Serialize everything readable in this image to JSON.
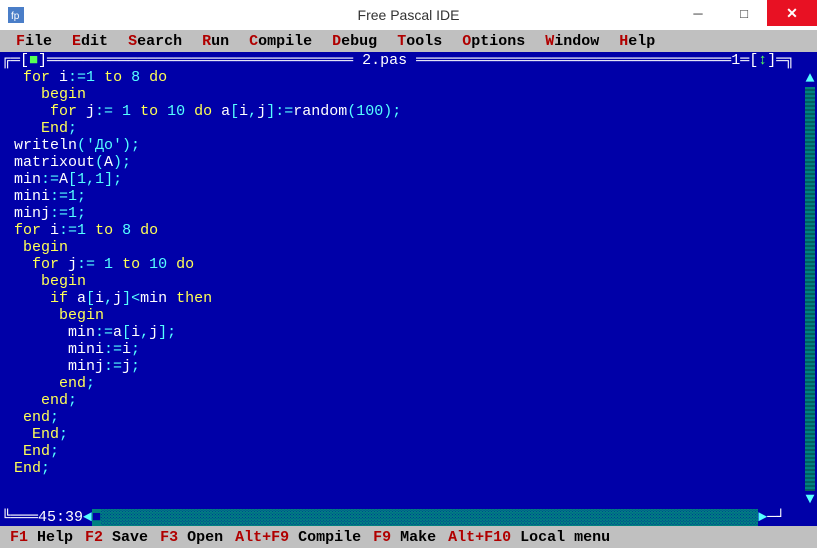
{
  "window": {
    "title": "Free Pascal IDE"
  },
  "menu": [
    {
      "hotkey": "F",
      "rest": "ile"
    },
    {
      "hotkey": "E",
      "rest": "dit"
    },
    {
      "hotkey": "S",
      "rest": "earch"
    },
    {
      "hotkey": "R",
      "rest": "un"
    },
    {
      "hotkey": "C",
      "rest": "ompile"
    },
    {
      "hotkey": "D",
      "rest": "ebug"
    },
    {
      "hotkey": "T",
      "rest": "ools"
    },
    {
      "hotkey": "O",
      "rest": "ptions"
    },
    {
      "hotkey": "W",
      "rest": "indow"
    },
    {
      "hotkey": "H",
      "rest": "elp"
    }
  ],
  "editor": {
    "filename": "2.pas",
    "window_number": "1",
    "cursor_pos": "45:39",
    "lines": [
      [
        {
          "c": "y",
          "t": " for "
        },
        {
          "c": "w",
          "t": "i"
        },
        {
          "c": "c",
          "t": ":="
        },
        {
          "c": "c",
          "t": "1"
        },
        {
          "c": "y",
          "t": " to "
        },
        {
          "c": "c",
          "t": "8"
        },
        {
          "c": "y",
          "t": " do"
        }
      ],
      [
        {
          "c": "y",
          "t": "   begin"
        }
      ],
      [
        {
          "c": "y",
          "t": "    for "
        },
        {
          "c": "w",
          "t": "j"
        },
        {
          "c": "c",
          "t": ":= "
        },
        {
          "c": "c",
          "t": "1"
        },
        {
          "c": "y",
          "t": " to "
        },
        {
          "c": "c",
          "t": "10"
        },
        {
          "c": "y",
          "t": " do "
        },
        {
          "c": "w",
          "t": "a"
        },
        {
          "c": "c",
          "t": "["
        },
        {
          "c": "w",
          "t": "i"
        },
        {
          "c": "c",
          "t": ","
        },
        {
          "c": "w",
          "t": "j"
        },
        {
          "c": "c",
          "t": "]:="
        },
        {
          "c": "w",
          "t": "random"
        },
        {
          "c": "c",
          "t": "("
        },
        {
          "c": "c",
          "t": "100"
        },
        {
          "c": "c",
          "t": ");"
        }
      ],
      [
        {
          "c": "y",
          "t": "   End"
        },
        {
          "c": "c",
          "t": ";"
        }
      ],
      [
        {
          "c": "w",
          "t": "writeln"
        },
        {
          "c": "c",
          "t": "('До');"
        }
      ],
      [
        {
          "c": "w",
          "t": "matrixout"
        },
        {
          "c": "c",
          "t": "("
        },
        {
          "c": "w",
          "t": "A"
        },
        {
          "c": "c",
          "t": ");"
        }
      ],
      [
        {
          "c": "w",
          "t": "min"
        },
        {
          "c": "c",
          "t": ":="
        },
        {
          "c": "w",
          "t": "A"
        },
        {
          "c": "c",
          "t": "["
        },
        {
          "c": "c",
          "t": "1"
        },
        {
          "c": "c",
          "t": ","
        },
        {
          "c": "c",
          "t": "1"
        },
        {
          "c": "c",
          "t": "];"
        }
      ],
      [
        {
          "c": "w",
          "t": "mini"
        },
        {
          "c": "c",
          "t": ":="
        },
        {
          "c": "c",
          "t": "1"
        },
        {
          "c": "c",
          "t": ";"
        }
      ],
      [
        {
          "c": "w",
          "t": "minj"
        },
        {
          "c": "c",
          "t": ":="
        },
        {
          "c": "c",
          "t": "1"
        },
        {
          "c": "c",
          "t": ";"
        }
      ],
      [
        {
          "c": "y",
          "t": "for "
        },
        {
          "c": "w",
          "t": "i"
        },
        {
          "c": "c",
          "t": ":="
        },
        {
          "c": "c",
          "t": "1"
        },
        {
          "c": "y",
          "t": " to "
        },
        {
          "c": "c",
          "t": "8"
        },
        {
          "c": "y",
          "t": " do"
        }
      ],
      [
        {
          "c": "y",
          "t": " begin"
        }
      ],
      [
        {
          "c": "y",
          "t": "  for "
        },
        {
          "c": "w",
          "t": "j"
        },
        {
          "c": "c",
          "t": ":= "
        },
        {
          "c": "c",
          "t": "1"
        },
        {
          "c": "y",
          "t": " to "
        },
        {
          "c": "c",
          "t": "10"
        },
        {
          "c": "y",
          "t": " do"
        }
      ],
      [
        {
          "c": "y",
          "t": "   begin"
        }
      ],
      [
        {
          "c": "y",
          "t": "    if "
        },
        {
          "c": "w",
          "t": "a"
        },
        {
          "c": "c",
          "t": "["
        },
        {
          "c": "w",
          "t": "i"
        },
        {
          "c": "c",
          "t": ","
        },
        {
          "c": "w",
          "t": "j"
        },
        {
          "c": "c",
          "t": "]<"
        },
        {
          "c": "w",
          "t": "min"
        },
        {
          "c": "y",
          "t": " then"
        }
      ],
      [
        {
          "c": "y",
          "t": "     begin"
        }
      ],
      [
        {
          "c": "w",
          "t": "      min"
        },
        {
          "c": "c",
          "t": ":="
        },
        {
          "c": "w",
          "t": "a"
        },
        {
          "c": "c",
          "t": "["
        },
        {
          "c": "w",
          "t": "i"
        },
        {
          "c": "c",
          "t": ","
        },
        {
          "c": "w",
          "t": "j"
        },
        {
          "c": "c",
          "t": "];"
        }
      ],
      [
        {
          "c": "w",
          "t": "      mini"
        },
        {
          "c": "c",
          "t": ":="
        },
        {
          "c": "w",
          "t": "i"
        },
        {
          "c": "c",
          "t": ";"
        }
      ],
      [
        {
          "c": "w",
          "t": "      minj"
        },
        {
          "c": "c",
          "t": ":="
        },
        {
          "c": "w",
          "t": "j"
        },
        {
          "c": "c",
          "t": ";"
        }
      ],
      [
        {
          "c": "y",
          "t": "     end"
        },
        {
          "c": "c",
          "t": ";"
        }
      ],
      [
        {
          "c": "y",
          "t": "   end"
        },
        {
          "c": "c",
          "t": ";"
        }
      ],
      [
        {
          "c": "y",
          "t": " end"
        },
        {
          "c": "c",
          "t": ";"
        }
      ],
      [
        {
          "c": "y",
          "t": "  End"
        },
        {
          "c": "c",
          "t": ";"
        }
      ],
      [
        {
          "c": "y",
          "t": " End"
        },
        {
          "c": "c",
          "t": ";"
        }
      ],
      [
        {
          "c": "y",
          "t": "End"
        },
        {
          "c": "c",
          "t": ";"
        }
      ]
    ]
  },
  "fnkeys": [
    {
      "key": "F1",
      "label": "Help"
    },
    {
      "key": "F2",
      "label": "Save"
    },
    {
      "key": "F3",
      "label": "Open"
    },
    {
      "key": "Alt+F9",
      "label": "Compile"
    },
    {
      "key": "F9",
      "label": "Make"
    },
    {
      "key": "Alt+F10",
      "label": "Local menu"
    }
  ]
}
